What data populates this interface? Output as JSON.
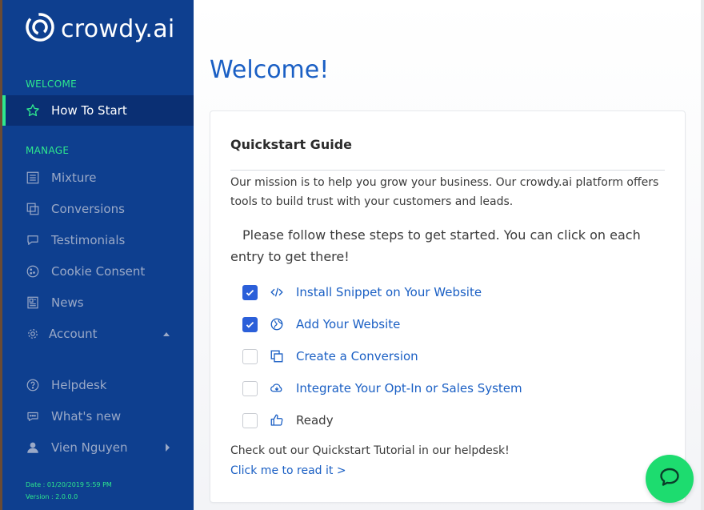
{
  "brand": {
    "name": "crowdy.ai"
  },
  "colors": {
    "sidebar": "#0e3f8f",
    "accent_green": "#2ee88e",
    "link_blue": "#1a5fc4",
    "checkbox_blue": "#2b5fd9",
    "chat_green": "#1ddc6f"
  },
  "sidebar": {
    "welcome_title": "WELCOME",
    "how_to_start": "How To Start",
    "manage_title": "MANAGE",
    "items": [
      {
        "label": "Mixture",
        "icon": "list-icon"
      },
      {
        "label": "Conversions",
        "icon": "copy-icon"
      },
      {
        "label": "Testimonials",
        "icon": "chat-bubble-icon"
      },
      {
        "label": "Cookie Consent",
        "icon": "cookie-icon"
      },
      {
        "label": "News",
        "icon": "newspaper-icon"
      },
      {
        "label": "Account",
        "icon": "gear-icon"
      }
    ],
    "helpdesk": "Helpdesk",
    "whats_new": "What's new",
    "user": "Vien Nguyen",
    "date": "Date : 01/20/2019 5:59 PM",
    "version": "Version : 2.0.0.0"
  },
  "main": {
    "title": "Welcome!",
    "card": {
      "title": "Quickstart Guide",
      "mission": "Our mission is to help you grow your business. Our crowdy.ai platform offers tools to build trust with your customers and leads.",
      "follow": "Please follow these steps to get started. You can click on each entry to get there!",
      "steps": [
        {
          "label": "Install Snippet on Your Website",
          "checked": true,
          "icon": "code-icon"
        },
        {
          "label": "Add Your Website",
          "checked": true,
          "icon": "globe-icon"
        },
        {
          "label": "Create a Conversion",
          "checked": false,
          "icon": "copy-icon"
        },
        {
          "label": "Integrate Your Opt-In or Sales System",
          "checked": false,
          "icon": "cloud-download-icon"
        },
        {
          "label": "Ready",
          "checked": false,
          "icon": "thumbs-up-icon"
        }
      ],
      "tutorial": "Check out our Quickstart Tutorial in our helpdesk!",
      "read_link": "Click me to read it >"
    }
  }
}
